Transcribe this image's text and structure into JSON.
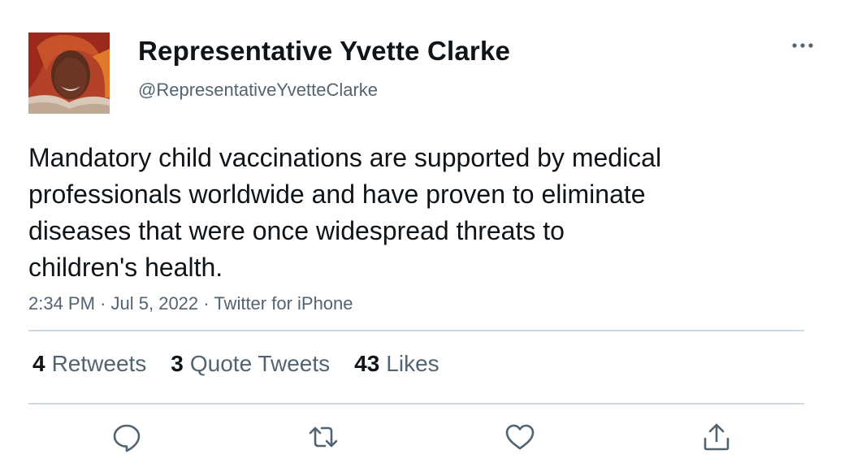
{
  "tweet": {
    "author": {
      "display_name": "Representative Yvette Clarke",
      "handle": "@RepresentativeYvetteClarke",
      "avatar": "profile-photo"
    },
    "text_lines": [
      "Mandatory child vaccinations are supported by medical",
      "professionals worldwide and have proven to eliminate",
      "diseases that were once widespread threats to",
      "children's health."
    ],
    "time": "2:34 PM",
    "date": "Jul 5, 2022",
    "source": "Twitter for iPhone",
    "separator": "·",
    "stats": {
      "retweets": {
        "count": "4",
        "label": "Retweets"
      },
      "quotes": {
        "count": "3",
        "label": "Quote Tweets"
      },
      "likes": {
        "count": "43",
        "label": "Likes"
      }
    }
  },
  "actions": {
    "reply": "reply-icon",
    "retweet": "retweet-icon",
    "like": "heart-icon",
    "share": "share-icon",
    "more": "more-dots-icon"
  },
  "colors": {
    "text": "#0f1419",
    "secondary": "#536471",
    "divider": "#cfd9de",
    "icon": "#536471"
  }
}
